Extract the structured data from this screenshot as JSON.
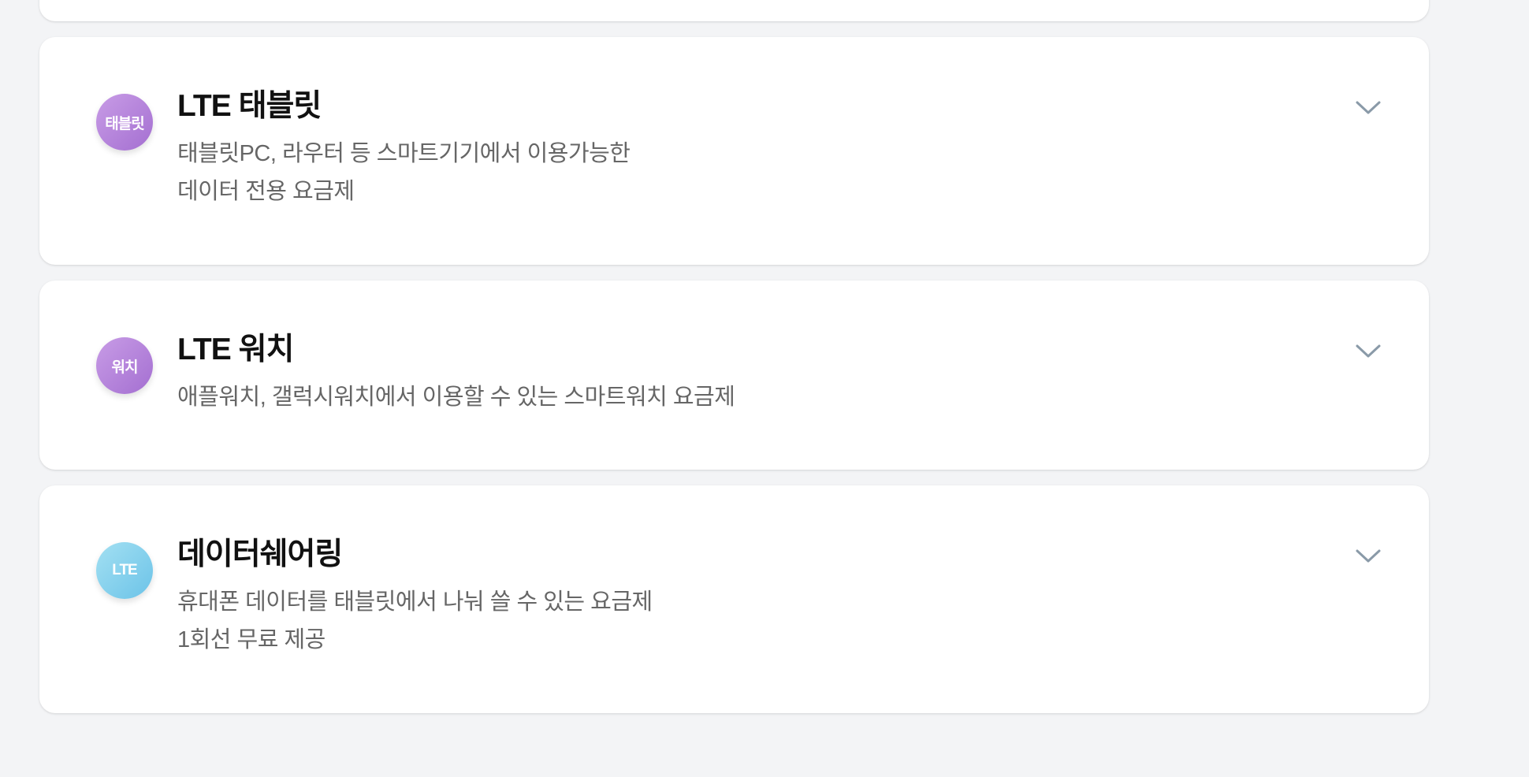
{
  "plans": [
    {
      "badge": "태블릿",
      "title": "LTE 태블릿",
      "description": [
        "태블릿PC, 라우터 등 스마트기기에서 이용가능한",
        "데이터 전용 요금제"
      ],
      "badge_color": "#b07fd9"
    },
    {
      "badge": "워치",
      "title": "LTE 워치",
      "description": [
        "애플워치, 갤럭시워치에서 이용할 수 있는 스마트워치 요금제"
      ],
      "badge_color": "#b07fd9"
    },
    {
      "badge": "LTE",
      "title": "데이터쉐어링",
      "description": [
        "휴대폰 데이터를 태블릿에서 나눠 쓸 수 있는 요금제",
        "1회선 무료 제공"
      ],
      "badge_color": "#7ccbea"
    }
  ],
  "icons": {
    "expand": "chevron-down-icon"
  },
  "colors": {
    "background": "#f3f4f6",
    "card": "#ffffff",
    "title": "#111111",
    "description": "#666666",
    "chevron": "#8a9aa8"
  }
}
